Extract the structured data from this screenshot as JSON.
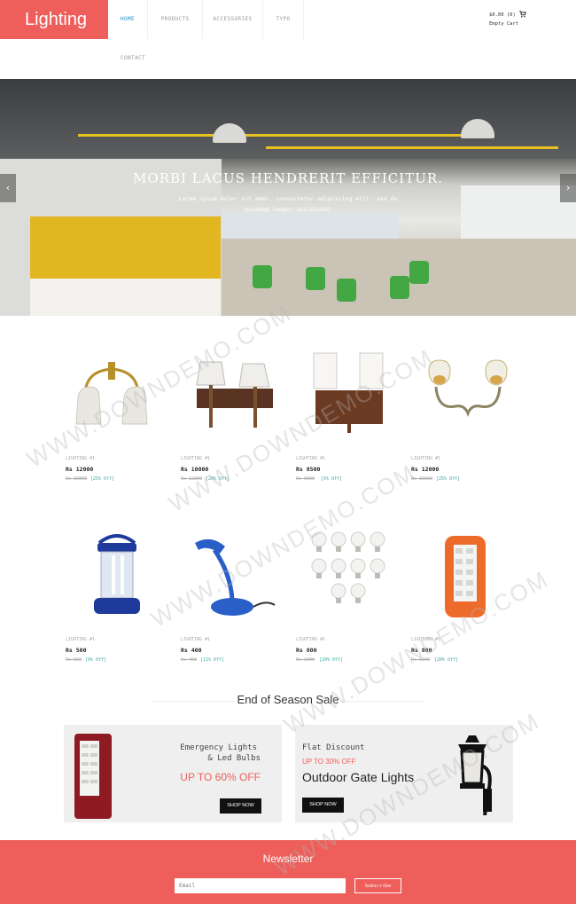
{
  "brand": {
    "logo": "Lighting",
    "accent": "#ee5e5a"
  },
  "nav": {
    "items": [
      {
        "label": "HOME",
        "active": true
      },
      {
        "label": "PRODUCTS",
        "active": false
      },
      {
        "label": "ACCESSORIES",
        "active": false
      },
      {
        "label": "TYPO",
        "active": false
      },
      {
        "label": "CONTACT",
        "active": false
      }
    ]
  },
  "cart": {
    "total": "$0.00 (0)",
    "status": "Empty Cart",
    "icon": "cart-icon"
  },
  "banner": {
    "title": "MORBI LACUS HENDRERIT EFFICITUR.",
    "subtitle": "Lorem ipsum dolor sit amet, consectetur adipiscing elit, sed do eiusmod tempor incididunt",
    "prev_icon": "chevron-left-icon",
    "next_icon": "chevron-right-icon"
  },
  "products": [
    {
      "category": "LIGHTING #1",
      "price": "Rs 12000",
      "old_price": "Rs 16000",
      "discount": "[25% Off]",
      "icon": "wall-lamp-brass-icon"
    },
    {
      "category": "LIGHTING #1",
      "price": "Rs 10000",
      "old_price": "Rs 12000",
      "discount": "[20% Off]",
      "icon": "wall-lamp-wood-icon"
    },
    {
      "category": "LIGHTING #1",
      "price": "Rs 8500",
      "old_price": "Rs 9000",
      "discount": "[5% Off]",
      "icon": "wall-lamp-square-icon"
    },
    {
      "category": "LIGHTING #1",
      "price": "Rs 12000",
      "old_price": "Rs 16000",
      "discount": "[25% Off]",
      "icon": "wall-lamp-antique-icon"
    },
    {
      "category": "LIGHTING #1",
      "price": "Rs 500",
      "old_price": "Rs 550",
      "discount": "[9% Off]",
      "icon": "lantern-icon"
    },
    {
      "category": "LIGHTING #1",
      "price": "Rs 400",
      "old_price": "Rs 450",
      "discount": "[11% Off]",
      "icon": "desk-lamp-icon"
    },
    {
      "category": "LIGHTING #1",
      "price": "Rs 800",
      "old_price": "Rs 1000",
      "discount": "[20% Off]",
      "icon": "led-bulbs-icon"
    },
    {
      "category": "LIGHTING #1",
      "price": "Rs 800",
      "old_price": "Rs 1000",
      "discount": "[20% Off]",
      "icon": "emergency-light-icon"
    }
  ],
  "sale": {
    "title": "End of Season Sale",
    "left": {
      "heading_line1": "Emergency Lights",
      "heading_line2": "& Led Bulbs",
      "offer": "UP TO 60% OFF",
      "button": "SHOP NOW"
    },
    "right": {
      "heading": "Flat Discount",
      "offer": "UP TO 30% OFF",
      "product": "Outdoor Gate Lights",
      "button": "SHOP NOW"
    }
  },
  "newsletter": {
    "title": "Newsletter",
    "placeholder": "Email",
    "button": "Subscribe"
  },
  "watermark": "WWW.DOWNDEMO.COM"
}
